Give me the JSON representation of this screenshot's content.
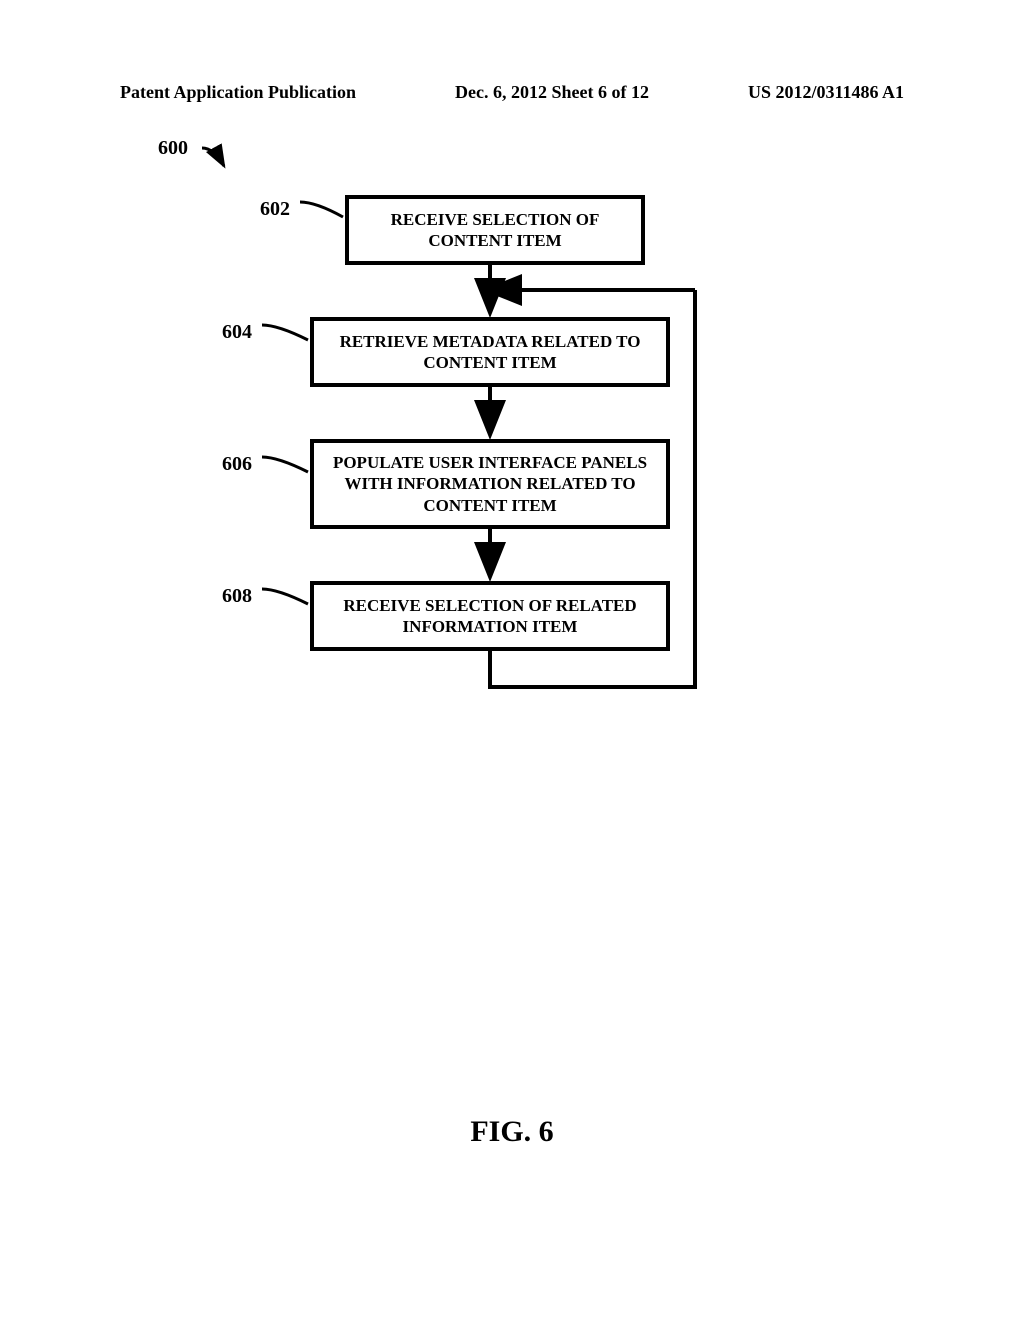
{
  "header": {
    "left": "Patent Application Publication",
    "center": "Dec. 6, 2012   Sheet 6 of 12",
    "right": "US 2012/0311486 A1"
  },
  "figure_ref": "600",
  "boxes": {
    "b602": {
      "label": "602",
      "text": "RECEIVE SELECTION OF CONTENT ITEM"
    },
    "b604": {
      "label": "604",
      "text": "RETRIEVE METADATA RELATED TO CONTENT ITEM"
    },
    "b606": {
      "label": "606",
      "text": "POPULATE USER INTERFACE PANELS WITH INFORMATION RELATED TO CONTENT ITEM"
    },
    "b608": {
      "label": "608",
      "text": "RECEIVE SELECTION OF RELATED INFORMATION ITEM"
    }
  },
  "figure_caption": "FIG. 6"
}
